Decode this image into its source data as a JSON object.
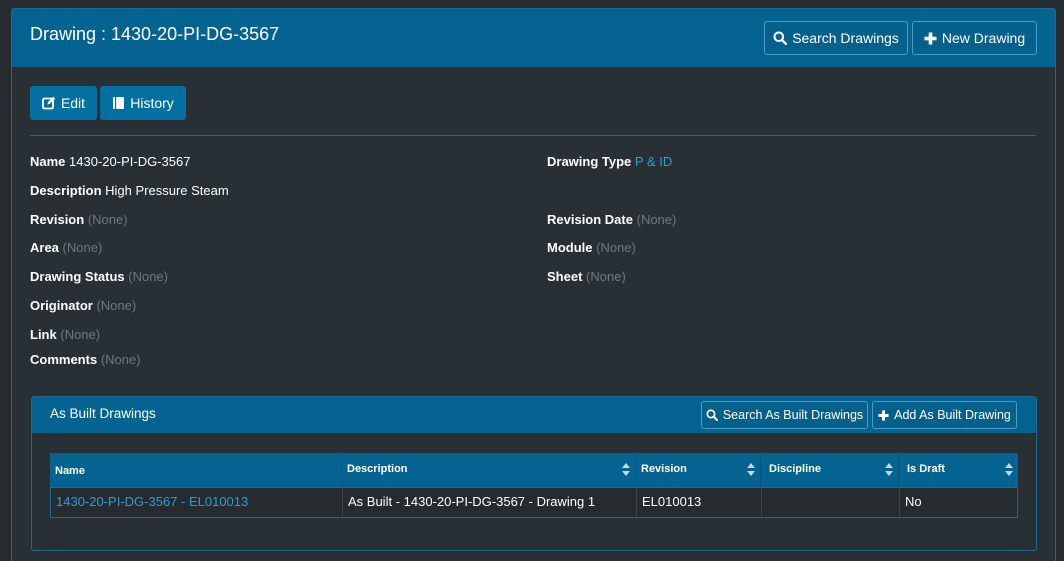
{
  "header": {
    "title": "Drawing : 1430-20-PI-DG-3567",
    "search_label": "Search Drawings",
    "new_label": "New Drawing"
  },
  "actions": {
    "edit_label": "Edit",
    "history_label": "History"
  },
  "fields": {
    "name": {
      "label": "Name",
      "value": "1430-20-PI-DG-3567"
    },
    "description": {
      "label": "Description",
      "value": "High Pressure Steam"
    },
    "revision": {
      "label": "Revision",
      "value": "(None)"
    },
    "area": {
      "label": "Area",
      "value": "(None)"
    },
    "drawing_status": {
      "label": "Drawing Status",
      "value": "(None)"
    },
    "originator": {
      "label": "Originator",
      "value": "(None)"
    },
    "link": {
      "label": "Link",
      "value": "(None)"
    },
    "comments": {
      "label": "Comments",
      "value": "(None)"
    },
    "drawing_type": {
      "label": "Drawing Type",
      "value": "P & ID"
    },
    "revision_date": {
      "label": "Revision Date",
      "value": "(None)"
    },
    "module": {
      "label": "Module",
      "value": "(None)"
    },
    "sheet": {
      "label": "Sheet",
      "value": "(None)"
    }
  },
  "as_built": {
    "title": "As Built Drawings",
    "search_label": "Search As Built Drawings",
    "add_label": "Add As Built Drawing",
    "columns": [
      "Name",
      "Description",
      "Revision",
      "Discipline",
      "Is Draft"
    ],
    "rows": [
      {
        "name": "1430-20-PI-DG-3567 - EL010013",
        "description": "As Built - 1430-20-PI-DG-3567 - Drawing 1",
        "revision": "EL010013",
        "discipline": "",
        "is_draft": "No"
      }
    ]
  },
  "colors": {
    "header_bg": "#046391",
    "page_bg": "#252b2e",
    "link": "#2a9fd6",
    "muted": "#6b7880"
  },
  "icons": [
    "search-icon",
    "plus-icon",
    "edit-icon",
    "book-icon",
    "sort-icon"
  ]
}
